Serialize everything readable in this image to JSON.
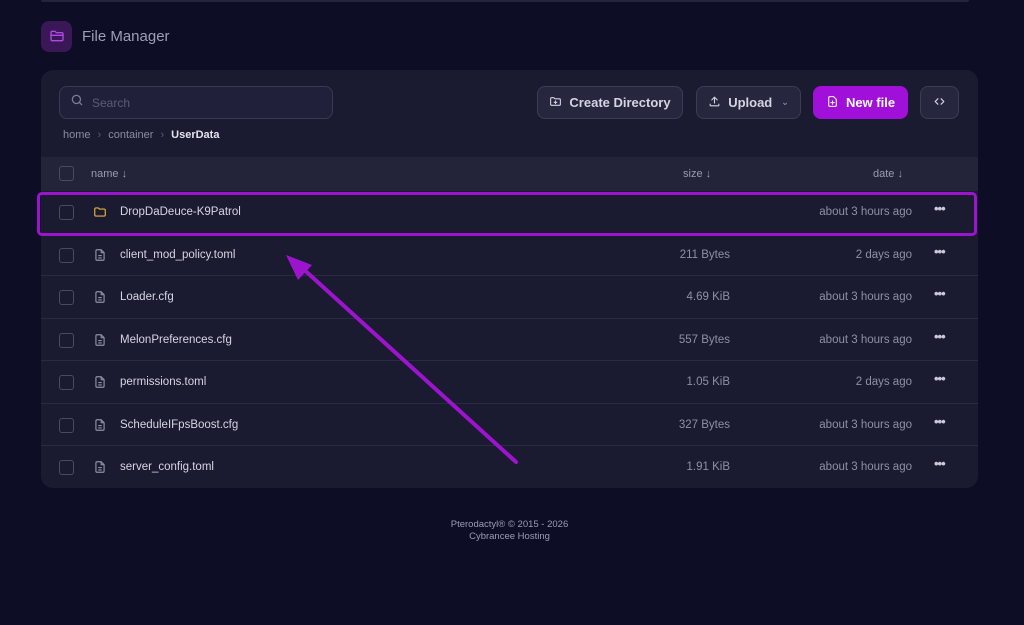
{
  "header": {
    "title": "File Manager"
  },
  "search": {
    "placeholder": "Search",
    "value": ""
  },
  "actions": {
    "create_directory": "Create Directory",
    "upload": "Upload",
    "new_file": "New file"
  },
  "breadcrumb": [
    "home",
    "container",
    "UserData"
  ],
  "table": {
    "columns": {
      "name": "name ↓",
      "size": "size ↓",
      "date": "date ↓"
    },
    "rows": [
      {
        "name": "DropDaDeuce-K9Patrol",
        "size": "",
        "date": "about 3 hours ago",
        "type": "folder",
        "highlighted": true
      },
      {
        "name": "client_mod_policy.toml",
        "size": "211 Bytes",
        "date": "2 days ago",
        "type": "file"
      },
      {
        "name": "Loader.cfg",
        "size": "4.69 KiB",
        "date": "about 3 hours ago",
        "type": "file"
      },
      {
        "name": "MelonPreferences.cfg",
        "size": "557 Bytes",
        "date": "about 3 hours ago",
        "type": "file"
      },
      {
        "name": "permissions.toml",
        "size": "1.05 KiB",
        "date": "2 days ago",
        "type": "file"
      },
      {
        "name": "ScheduleIFpsBoost.cfg",
        "size": "327 Bytes",
        "date": "about 3 hours ago",
        "type": "file"
      },
      {
        "name": "server_config.toml",
        "size": "1.91 KiB",
        "date": "about 3 hours ago",
        "type": "file"
      }
    ]
  },
  "footer": {
    "line1": "Pterodactyl® © 2015 - 2026",
    "line2": "Cybrancee Hosting"
  },
  "colors": {
    "accent": "#9d14cf",
    "primary_button": "#a010d8",
    "folder_icon": "#e8b23a",
    "background": "#0d0d26",
    "card": "#1a1a30"
  },
  "icons": {
    "logo": "folder-open-icon",
    "search": "search-icon",
    "create_directory": "folder-plus-icon",
    "upload": "upload-icon",
    "new_file": "file-plus-icon",
    "code": "code-icon",
    "folder": "folder-icon",
    "file": "file-text-icon",
    "more": "more-horizontal-icon"
  }
}
